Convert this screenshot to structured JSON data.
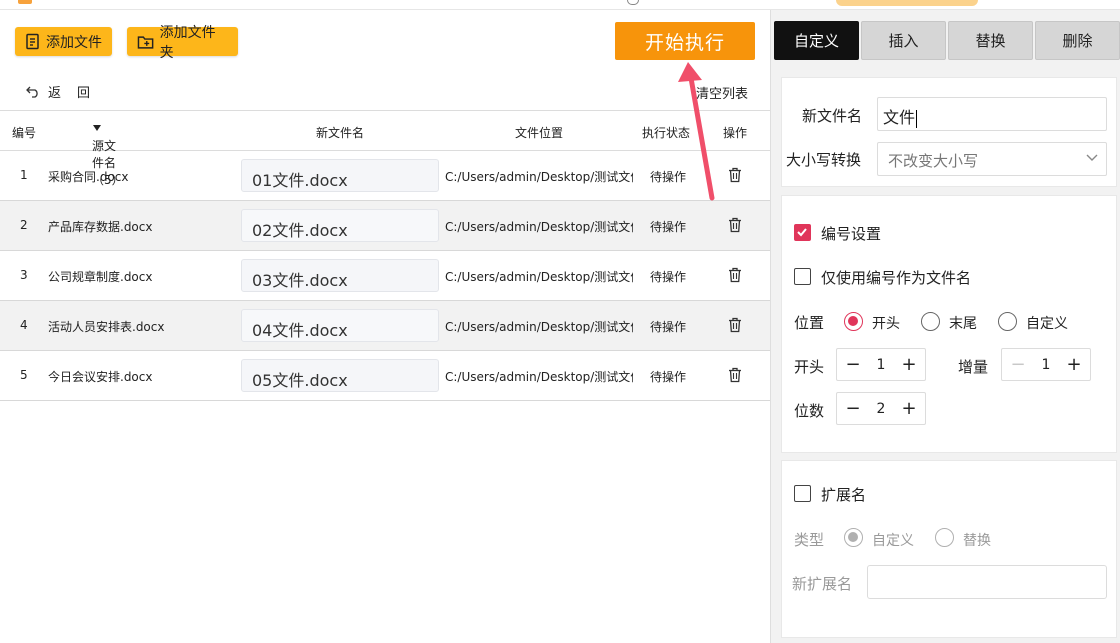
{
  "toolbar": {
    "add_file": "添加文件",
    "add_folder": "添加文件夹",
    "run": "开始执行"
  },
  "nav": {
    "back": "返",
    "back2": "回",
    "clear_list": "清空列表"
  },
  "table": {
    "headers": {
      "idx": "编号",
      "src": "源文件名（5）",
      "new": "新文件名",
      "path": "文件位置",
      "status": "执行状态",
      "op": "操作"
    },
    "rows": [
      {
        "idx": "1",
        "src": "采购合同.docx",
        "new": "01文件.docx",
        "path": "C:/Users/admin/Desktop/测试文件",
        "status": "待操作"
      },
      {
        "idx": "2",
        "src": "产品库存数据.docx",
        "new": "02文件.docx",
        "path": "C:/Users/admin/Desktop/测试文件",
        "status": "待操作"
      },
      {
        "idx": "3",
        "src": "公司规章制度.docx",
        "new": "03文件.docx",
        "path": "C:/Users/admin/Desktop/测试文件",
        "status": "待操作"
      },
      {
        "idx": "4",
        "src": "活动人员安排表.docx",
        "new": "04文件.docx",
        "path": "C:/Users/admin/Desktop/测试文件",
        "status": "待操作"
      },
      {
        "idx": "5",
        "src": "今日会议安排.docx",
        "new": "05文件.docx",
        "path": "C:/Users/admin/Desktop/测试文件",
        "status": "待操作"
      }
    ]
  },
  "tabs": [
    "自定义",
    "插入",
    "替换",
    "删除"
  ],
  "panel": {
    "new_name_label": "新文件名",
    "new_name_value": "文件",
    "case_label": "大小写转换",
    "case_value": "不改变大小写",
    "numbering_label": "编号设置",
    "only_number_label": "仅使用编号作为文件名",
    "position_label": "位置",
    "pos_start": "开头",
    "pos_end": "末尾",
    "pos_custom": "自定义",
    "start_label": "开头",
    "start_value": "1",
    "increment_label": "增量",
    "increment_value": "1",
    "digits_label": "位数",
    "digits_value": "2",
    "ext_label": "扩展名",
    "type_label": "类型",
    "type_custom": "自定义",
    "type_replace": "替换",
    "new_ext_label": "新扩展名"
  },
  "colors": {
    "accent": "#f7940b",
    "toolbar_button": "#fdb61a",
    "checkbox": "#e0355a",
    "tab_active": "#111111"
  }
}
